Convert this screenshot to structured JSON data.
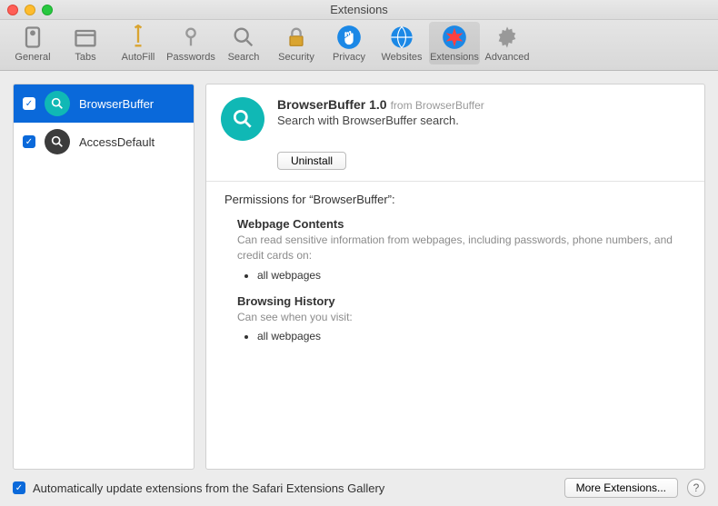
{
  "window_title": "Extensions",
  "toolbar": [
    {
      "label": "General"
    },
    {
      "label": "Tabs"
    },
    {
      "label": "AutoFill"
    },
    {
      "label": "Passwords"
    },
    {
      "label": "Search"
    },
    {
      "label": "Security"
    },
    {
      "label": "Privacy"
    },
    {
      "label": "Websites"
    },
    {
      "label": "Extensions"
    },
    {
      "label": "Advanced"
    }
  ],
  "extensions": [
    {
      "name": "BrowserBuffer",
      "checked": true,
      "selected": true,
      "icon_style": "teal"
    },
    {
      "name": "AccessDefault",
      "checked": true,
      "selected": false,
      "icon_style": "dark"
    }
  ],
  "detail": {
    "title": "BrowserBuffer 1.0",
    "from": "from BrowserBuffer",
    "description": "Search with BrowserBuffer search.",
    "uninstall_label": "Uninstall",
    "permissions_title": "Permissions for “BrowserBuffer”:",
    "sections": [
      {
        "heading": "Webpage Contents",
        "desc": "Can read sensitive information from webpages, including passwords, phone numbers, and credit cards on:",
        "items": [
          "all webpages"
        ]
      },
      {
        "heading": "Browsing History",
        "desc": "Can see when you visit:",
        "items": [
          "all webpages"
        ]
      }
    ]
  },
  "footer": {
    "auto_update_label": "Automatically update extensions from the Safari Extensions Gallery",
    "auto_update_checked": true,
    "more_label": "More Extensions...",
    "help": "?"
  }
}
